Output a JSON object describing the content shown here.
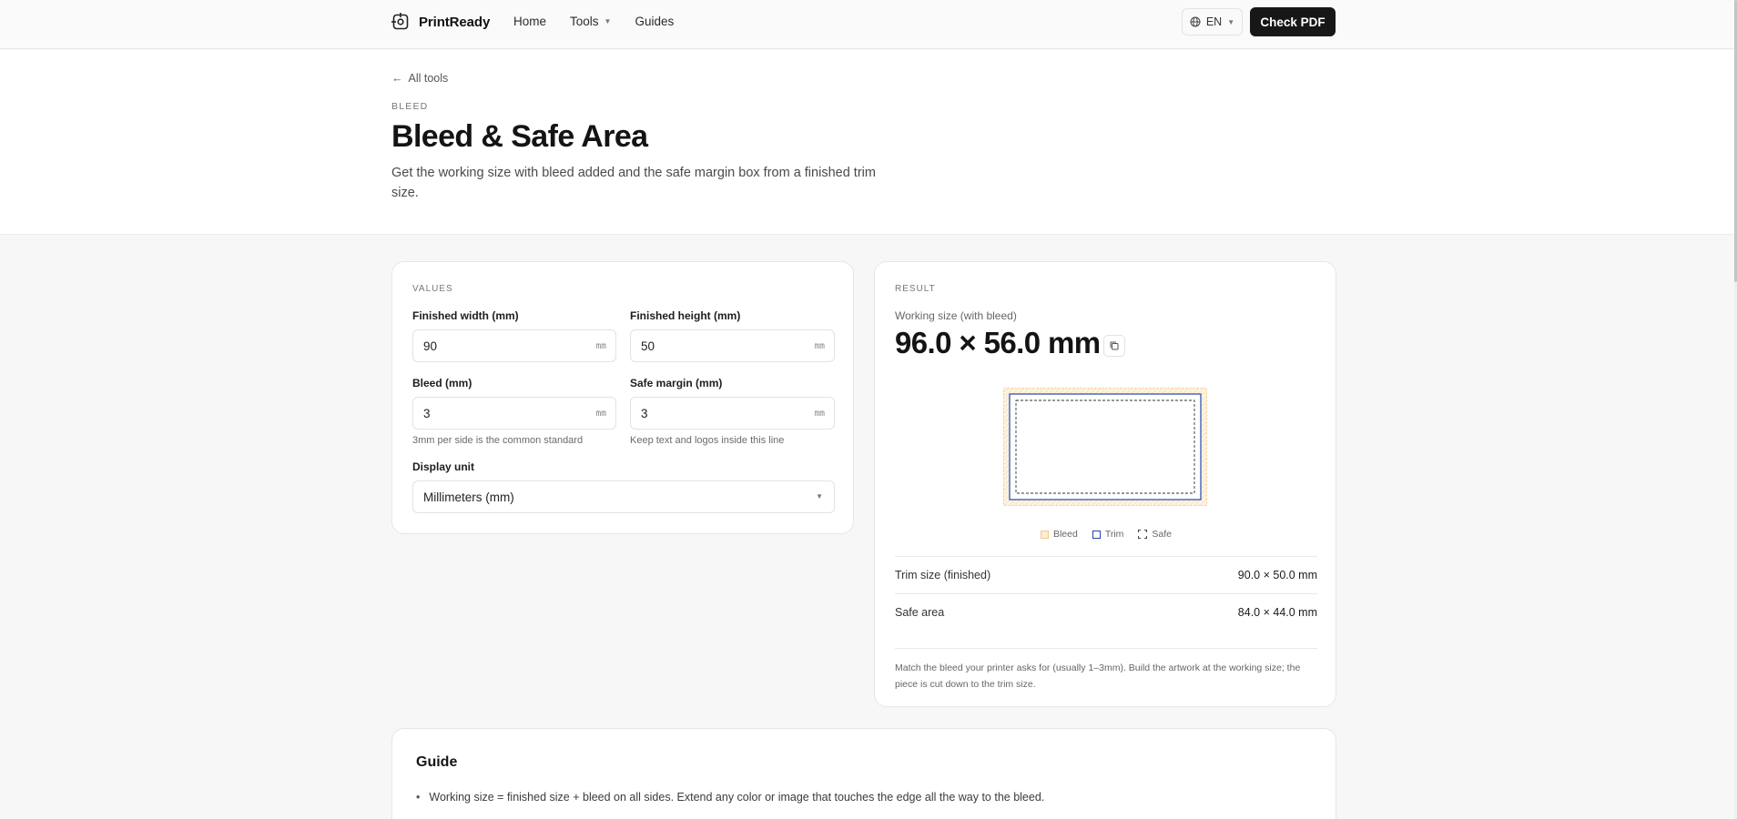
{
  "header": {
    "brand": "PrintReady",
    "nav": [
      {
        "label": "Home"
      },
      {
        "label": "Tools"
      },
      {
        "label": "Guides"
      }
    ],
    "language": "EN",
    "cta": "Check PDF"
  },
  "hero": {
    "back_link": "All tools",
    "eyebrow": "BLEED",
    "title": "Bleed & Safe Area",
    "subtitle": "Get the working size with bleed added and the safe margin box from a finished trim size."
  },
  "values": {
    "section_label": "VALUES",
    "fields": {
      "width": {
        "label": "Finished width (mm)",
        "value": "90",
        "unit": "mm"
      },
      "height": {
        "label": "Finished height (mm)",
        "value": "50",
        "unit": "mm"
      },
      "bleed": {
        "label": "Bleed (mm)",
        "value": "3",
        "unit": "mm",
        "hint": "3mm per side is the common standard"
      },
      "safe": {
        "label": "Safe margin (mm)",
        "value": "3",
        "unit": "mm",
        "hint": "Keep text and logos inside this line"
      }
    },
    "display_unit": {
      "label": "Display unit",
      "selected": "Millimeters (mm)"
    }
  },
  "result": {
    "section_label": "RESULT",
    "working_label": "Working size (with bleed)",
    "working_value": "96.0 × 56.0 mm",
    "legend": {
      "bleed": "Bleed",
      "trim": "Trim",
      "safe": "Safe"
    },
    "rows": [
      {
        "label": "Trim size (finished)",
        "value": "90.0 × 50.0 mm"
      },
      {
        "label": "Safe area",
        "value": "84.0 × 44.0 mm"
      }
    ],
    "note": "Match the bleed your printer asks for (usually 1–3mm). Build the artwork at the working size; the piece is cut down to the trim size."
  },
  "guide": {
    "title": "Guide",
    "items": [
      "Working size = finished size + bleed on all sides. Extend any color or image that touches the edge all the way to the bleed."
    ]
  },
  "colors": {
    "primary": "#171717",
    "trim": "#2446a8",
    "bleed_fill": "#fdecd2",
    "bleed_border": "#f2c98f"
  }
}
